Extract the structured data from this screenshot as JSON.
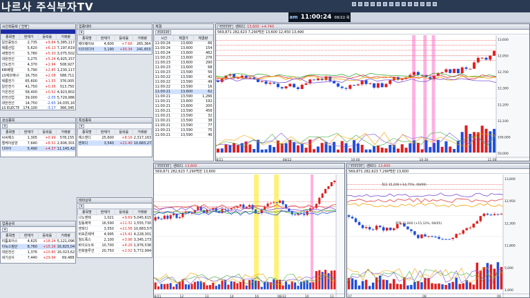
{
  "app": {
    "brand": "나르사 주식부자TV",
    "clock_ampm": "am",
    "clock_time": "11:00:24",
    "clock_date": "08/22 목",
    "colors": {
      "up": "#d41c1c",
      "down": "#1f4fd8",
      "titlebar": "#2a3a52"
    }
  },
  "watchlist": {
    "title": "시간외등락",
    "tab": "상세",
    "columns": [
      "종목명",
      "현재가",
      "등락률",
      "거래량"
    ],
    "rows": [
      [
        "일진홀딩스",
        "2,735",
        "+9.84",
        "5,385,117"
      ],
      [
        "제룡산업",
        "5,620",
        "+6.13",
        "7,197,619"
      ],
      [
        "세명전기",
        "5,780",
        "+5.30",
        "3,075,502"
      ],
      [
        "대원전선",
        "3,275",
        "+5.24",
        "6,925,157"
      ],
      [
        "선도전기",
        "4,370",
        "+2.94",
        "508,927"
      ],
      [
        "KBI메탈",
        "5,790",
        "+2.85",
        "1,230,117"
      ],
      [
        "LS에코에너지",
        "16,750",
        "+2.08",
        "588,711"
      ],
      [
        "제룡전기",
        "65,600",
        "+1.55",
        "376,005"
      ],
      [
        "일진전기",
        "41,750",
        "+0.36",
        "513,750"
      ],
      [
        "가온전선",
        "58,400",
        "+0.52",
        "4,923,802"
      ],
      [
        "한전산업",
        "39,000",
        "-2.05",
        "5,729,986"
      ],
      [
        "대한전선",
        "14,750",
        "-2.65",
        "14,035,167"
      ],
      [
        "LS ELECTRIC",
        "174,100",
        "-3.17",
        "366,345"
      ]
    ]
  },
  "sector": {
    "title": "업종테마",
    "columns": [
      "종목명",
      "현재가",
      "등락률",
      "거래량"
    ],
    "rows": [
      [
        "제이웨이브",
        "4,600",
        "+7.66",
        "265,364"
      ],
      [
        "이즈미디어",
        "3,190",
        "+30.34",
        "241,653"
      ]
    ]
  },
  "sector2": {
    "title": "관심종목",
    "columns": [
      "종목명",
      "현재가",
      "등락률",
      "거래량"
    ],
    "rows": [
      [
        "씨씨에스",
        "1,305",
        "+0.99",
        "578,155"
      ],
      [
        "엘케이삼양",
        "7,640",
        "+8.52",
        "2,606,301"
      ],
      [
        "디아이",
        "5,490",
        "+4.37",
        "11,145,428"
      ]
    ]
  },
  "sector3": {
    "title": "특징종목",
    "columns": [
      "종목명",
      "현재가",
      "등락률",
      "거래량"
    ],
    "rows": [
      [
        "에스앤디",
        "25,600",
        "+8.16",
        "2,317,163"
      ],
      [
        "엔피디",
        "3,540",
        "+21.40",
        "10,683,272"
      ]
    ]
  },
  "sector4": {
    "title": "테마상위",
    "columns": [
      "종목명",
      "현재가",
      "등락률",
      "거래량"
    ],
    "rows": [
      [
        "나노엔텍",
        "1,021",
        "+9.69",
        "5,045,615"
      ],
      [
        "일동제약",
        "16,590",
        "+11.32",
        "1,555,730"
      ],
      [
        "엔피디",
        "3,550",
        "+21.58",
        "10,683,570"
      ],
      [
        "비보존제약",
        "4,995",
        "+15.42",
        "4,228,301"
      ],
      [
        "월드폭스",
        "2,100",
        "+3.96",
        "3,345,173"
      ],
      [
        "바이오노트",
        "10,700",
        "+4.26",
        "1,976,536"
      ],
      [
        "한화솔루션",
        "20,750",
        "+2.02",
        "5,772,994"
      ]
    ]
  },
  "sector5": {
    "title": "업종순위",
    "columns": [
      "종목명",
      "현재가",
      "등락률",
      "거래량"
    ],
    "rows": [
      [
        "리튬포어스",
        "4,625",
        "+18.24",
        "5,121,096"
      ],
      [
        "이녹스첨단",
        "8,760",
        "+15.16",
        "16,825,041"
      ],
      [
        "대원전선",
        "1,376",
        "+10.80",
        "16,023,621"
      ],
      [
        "세기상사",
        "7,440",
        "+29.94",
        "69,488"
      ]
    ]
  },
  "ticks": {
    "title": "체결",
    "columns": [
      "시간",
      "체결가",
      "체결량"
    ],
    "rows": [
      [
        "11:00:24",
        "13,600",
        "66"
      ],
      [
        "11:00:24",
        "13,600",
        "154"
      ],
      [
        "11:00:24",
        "13,600",
        "462"
      ],
      [
        "11:00:23",
        "13,600",
        "276"
      ],
      [
        "11:00:23",
        "13,600",
        "290"
      ],
      [
        "11:00:23",
        "13,600",
        "68"
      ],
      [
        "11:00:23",
        "13,590",
        "56"
      ],
      [
        "11:00:22",
        "13,590",
        "42"
      ],
      [
        "11:00:22",
        "13,590",
        "49"
      ],
      [
        "11:00:22",
        "13,590",
        "16"
      ],
      [
        "11:00:21",
        "13,600",
        "62"
      ],
      [
        "11:00:21",
        "13,590",
        "1,266"
      ],
      [
        "11:00:21",
        "13,600",
        "192"
      ],
      [
        "11:00:21",
        "13,600",
        "200"
      ],
      [
        "11:00:21",
        "13,590",
        "456"
      ],
      [
        "11:00:21",
        "13,590",
        "32"
      ],
      [
        "11:00:21",
        "13,590",
        "38"
      ],
      [
        "11:00:21",
        "13,590",
        "77"
      ],
      [
        "11:00:21",
        "13,590",
        "75"
      ],
      [
        "11:00:21",
        "13,590",
        "46"
      ]
    ]
  },
  "chart_main": {
    "code": "450330",
    "name": "엔피디",
    "price": "13,600",
    "change": "+4.740",
    "info": "569,871  282,623  7,290백만  13,600  12,450  13,490",
    "y_labels": [
      "13,600",
      "12,950",
      "12,700",
      "12,300",
      "12,200",
      "12,100",
      "100,000",
      "50,000"
    ],
    "x_labels": [
      "08/21",
      "08/22",
      "10:00",
      "10:30",
      "11:00"
    ]
  },
  "chart_left": {
    "code": "450330",
    "name": "엔피디",
    "price": "13,600",
    "info": "569,871  282,623  7,290백만  13,600",
    "x_labels": [
      "08/21",
      "12",
      "13",
      "14",
      "16",
      "08/22",
      "10",
      "11"
    ]
  },
  "chart_right": {
    "code": "450330",
    "name": "엔피디",
    "price": "13,600",
    "info": "569,871  282,623  7,290백만  13,600",
    "annotations": [
      "최고 15,200 (-14,75%, 08/09)",
      "최저 11,800 (+15,12%, 08/05)"
    ],
    "y_labels": [
      "13,600",
      "12,950",
      "12,300",
      "11,800",
      "5,000",
      "1,000"
    ],
    "x_labels": [
      "07",
      "08",
      "09"
    ]
  },
  "icons": [
    "search-icon",
    "gear-icon",
    "close-icon",
    "pin-icon"
  ]
}
